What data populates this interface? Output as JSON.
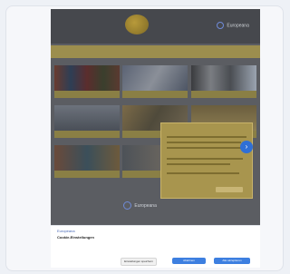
{
  "header": {
    "brand": "Europeana"
  },
  "nav": {
    "items": [
      "",
      "",
      "",
      "",
      "",
      ""
    ]
  },
  "tiles": [
    {
      "caption": ""
    },
    {
      "caption": ""
    },
    {
      "caption": ""
    },
    {
      "caption": ""
    },
    {
      "caption": ""
    },
    {
      "caption": ""
    },
    {
      "caption": ""
    },
    {
      "caption": ""
    }
  ],
  "popup": {
    "title": ""
  },
  "chat": {
    "icon": "chat-icon"
  },
  "footer": {
    "brand": "Europeana"
  },
  "cookie_banner": {
    "logo": "Europeana",
    "title": "Cookie-Einstellungen",
    "text": "",
    "link": "",
    "footer_text": "",
    "buttons": {
      "settings": "Einstellungen speichern",
      "decline": "Ablehnen",
      "accept": "Alle akzeptieren"
    }
  }
}
